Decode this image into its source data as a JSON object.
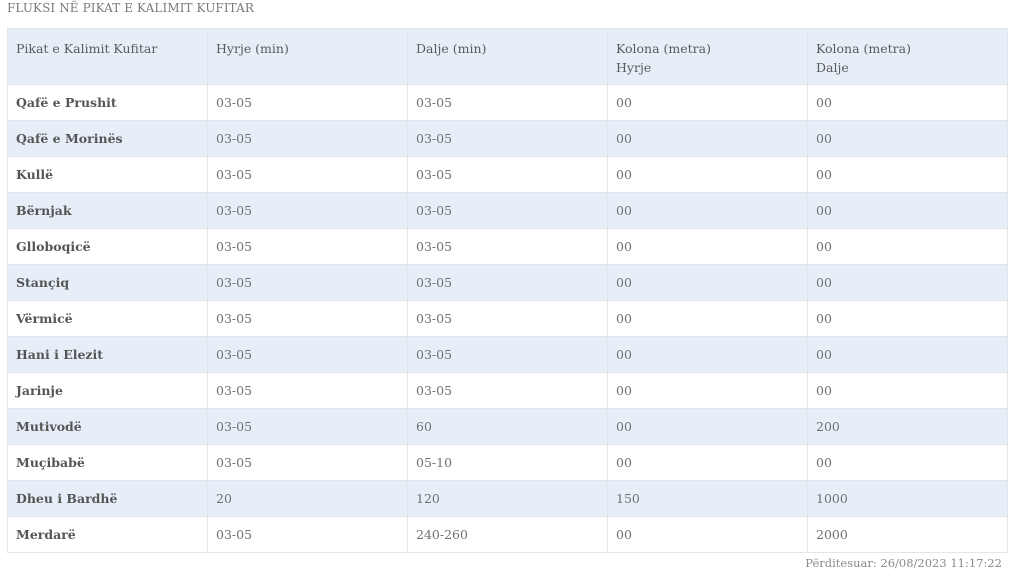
{
  "page": {
    "title": "FLUKSI NË PIKAT E KALIMIT KUFITAR",
    "updated": "Përditesuar: 26/08/2023 11:17:22"
  },
  "table": {
    "headers": [
      {
        "line1": "Pikat e Kalimit Kufitar",
        "line2": ""
      },
      {
        "line1": "Hyrje (min)",
        "line2": ""
      },
      {
        "line1": "Dalje (min)",
        "line2": ""
      },
      {
        "line1": "Kolona (metra)",
        "line2": "Hyrje"
      },
      {
        "line1": "Kolona (metra)",
        "line2": "Dalje"
      }
    ],
    "rows": [
      {
        "name": "Qafë e Prushit",
        "entry": "03-05",
        "exit": "03-05",
        "queue_in": "00",
        "queue_out": "00"
      },
      {
        "name": "Qafë e Morinës",
        "entry": "03-05",
        "exit": "03-05",
        "queue_in": "00",
        "queue_out": "00"
      },
      {
        "name": "Kullë",
        "entry": "03-05",
        "exit": "03-05",
        "queue_in": "00",
        "queue_out": "00"
      },
      {
        "name": "Bërnjak",
        "entry": "03-05",
        "exit": "03-05",
        "queue_in": "00",
        "queue_out": "00"
      },
      {
        "name": "Glloboqicë",
        "entry": "03-05",
        "exit": "03-05",
        "queue_in": "00",
        "queue_out": "00"
      },
      {
        "name": "Stançiq",
        "entry": "03-05",
        "exit": "03-05",
        "queue_in": "00",
        "queue_out": "00"
      },
      {
        "name": "Vërmicë",
        "entry": "03-05",
        "exit": "03-05",
        "queue_in": "00",
        "queue_out": "00"
      },
      {
        "name": "Hani i Elezit",
        "entry": "03-05",
        "exit": "03-05",
        "queue_in": "00",
        "queue_out": "00"
      },
      {
        "name": "Jarinje",
        "entry": "03-05",
        "exit": "03-05",
        "queue_in": "00",
        "queue_out": "00"
      },
      {
        "name": "Mutivodë",
        "entry": "03-05",
        "exit": "60",
        "queue_in": "00",
        "queue_out": "200"
      },
      {
        "name": "Muçibabë",
        "entry": "03-05",
        "exit": "05-10",
        "queue_in": "00",
        "queue_out": "00"
      },
      {
        "name": "Dheu i Bardhë",
        "entry": "20",
        "exit": "120",
        "queue_in": "150",
        "queue_out": "1000"
      },
      {
        "name": "Merdarë",
        "entry": "03-05",
        "exit": "240-260",
        "queue_in": "00",
        "queue_out": "2000"
      }
    ]
  }
}
